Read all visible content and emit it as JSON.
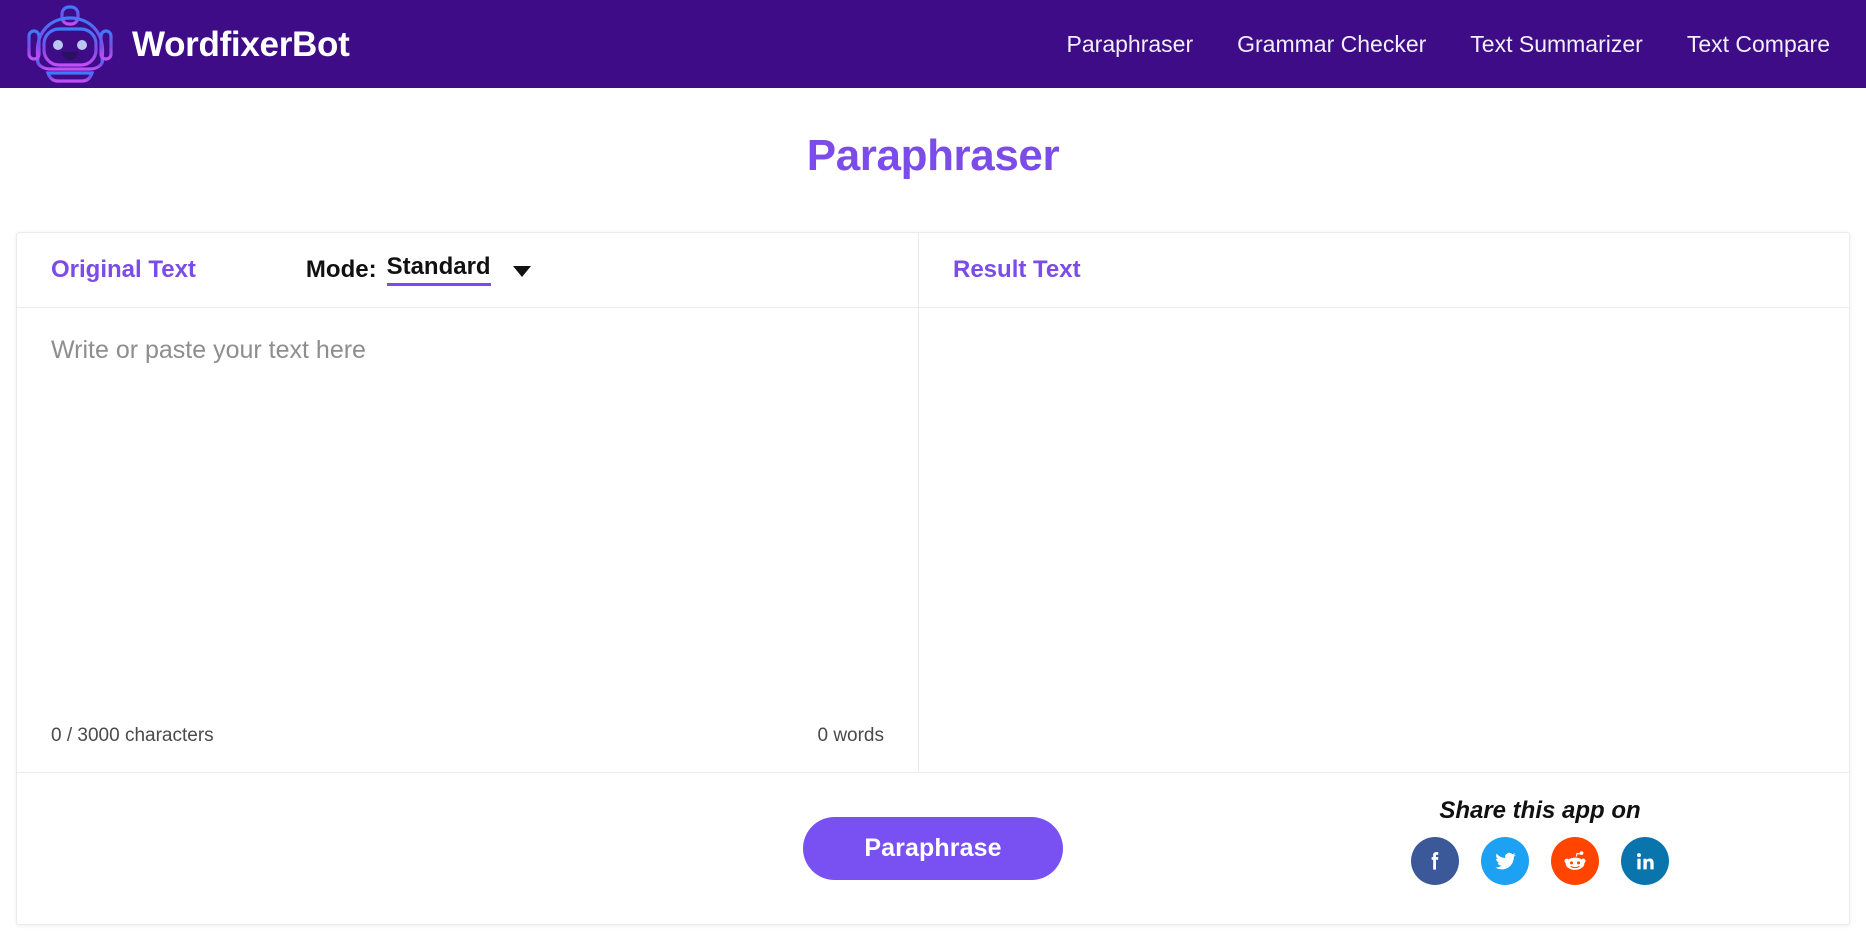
{
  "header": {
    "brand_name": "WordfixerBot",
    "logo_icon": "robot-logo-icon",
    "background_color": "#3d0c86",
    "nav": [
      {
        "label": "Paraphraser",
        "name": "nav-link-paraphraser"
      },
      {
        "label": "Grammar Checker",
        "name": "nav-link-grammar-checker"
      },
      {
        "label": "Text Summarizer",
        "name": "nav-link-text-summarizer"
      },
      {
        "label": "Text Compare",
        "name": "nav-link-text-compare"
      }
    ]
  },
  "page": {
    "title": "Paraphraser",
    "accent_color": "#7b4ce8"
  },
  "editor": {
    "original": {
      "title": "Original Text",
      "mode_label": "Mode:",
      "mode_value": "Standard",
      "mode_caret_icon": "chevron-down-icon",
      "placeholder": "Write or paste your text here",
      "value": "",
      "char_counter": "0 / 3000 characters",
      "word_counter": "0 words"
    },
    "result": {
      "title": "Result Text",
      "value": ""
    }
  },
  "actions": {
    "paraphrase_label": "Paraphrase",
    "paraphrase_color": "#7950f2",
    "share_label": "Share this app on",
    "share_icons": [
      {
        "name": "facebook-share-icon",
        "label": "Facebook",
        "color": "#3b5998"
      },
      {
        "name": "twitter-share-icon",
        "label": "Twitter",
        "color": "#1da1f2"
      },
      {
        "name": "reddit-share-icon",
        "label": "Reddit",
        "color": "#ff4500"
      },
      {
        "name": "linkedin-share-icon",
        "label": "LinkedIn",
        "color": "#0a75ad"
      }
    ]
  }
}
